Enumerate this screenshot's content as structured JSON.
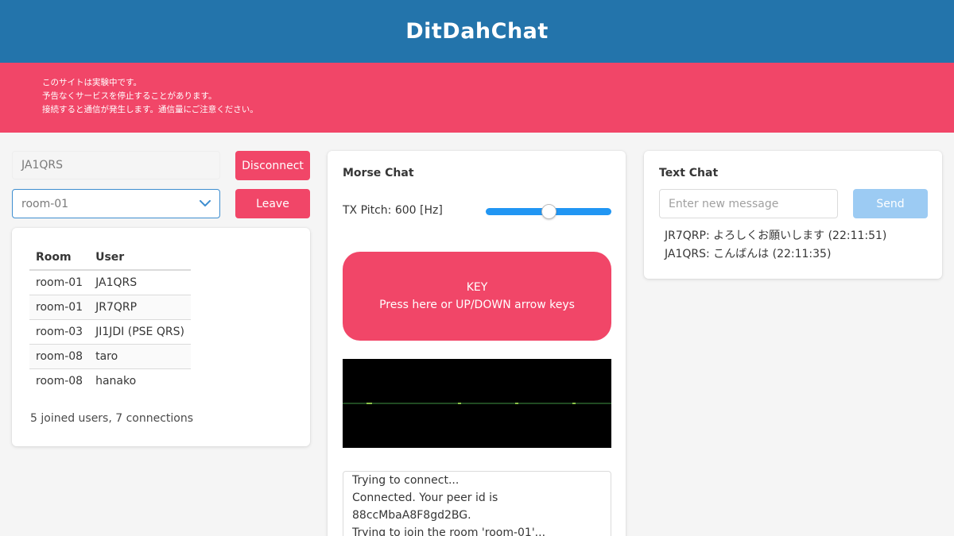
{
  "app": {
    "title": "DitDahChat"
  },
  "notice": {
    "lines": [
      "このサイトは実験中です。",
      "予告なくサービスを停止することがあります。",
      "接続すると通信が発生します。通信量にご注意ください。"
    ]
  },
  "connection": {
    "callsign": "JA1QRS",
    "disconnect_label": "Disconnect",
    "room_selected": "room-01",
    "leave_label": "Leave"
  },
  "users": {
    "headers": {
      "room": "Room",
      "user": "User"
    },
    "rows": [
      {
        "room": "room-01",
        "user": "JA1QRS"
      },
      {
        "room": "room-01",
        "user": "JR7QRP"
      },
      {
        "room": "room-03",
        "user": "JI1JDI (PSE QRS)"
      },
      {
        "room": "room-08",
        "user": "taro"
      },
      {
        "room": "room-08",
        "user": "hanako"
      }
    ],
    "summary": "5 joined users, 7 connections"
  },
  "morse": {
    "title": "Morse Chat",
    "pitch_label": "TX Pitch: 600 [Hz]",
    "pitch_fraction": 0.5,
    "key_title": "KEY",
    "key_hint": "Press here or UP/DOWN arrow keys",
    "log": [
      "Trying to connect...",
      "Connected. Your peer id is",
      "88ccMbaA8F8gd2BG.",
      "Trying to join the room 'room-01'..."
    ]
  },
  "text_chat": {
    "title": "Text Chat",
    "placeholder": "Enter new message",
    "send_label": "Send",
    "messages": [
      "JR7QRP: よろしくお願いします (22:11:51)",
      "JA1QRS: こんばんは (22:11:35)"
    ]
  },
  "colors": {
    "navbar": "#2374ab",
    "danger": "#f14668",
    "info": "#3e8ed0",
    "send_disabled": "#9ccbf3",
    "slider": "#2196f3",
    "scope_trace": "#4caf50"
  },
  "icons": {
    "select_arrow": "chevron-down-icon"
  }
}
